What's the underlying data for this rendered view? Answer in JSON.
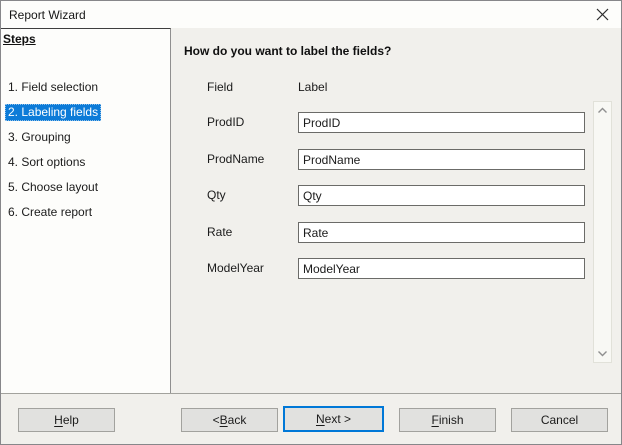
{
  "window": {
    "title": "Report Wizard"
  },
  "sidebar": {
    "heading": "Steps",
    "selected_index": 1,
    "items": [
      {
        "label": "1. Field selection"
      },
      {
        "label": "2. Labeling fields"
      },
      {
        "label": "3. Grouping"
      },
      {
        "label": "4. Sort options"
      },
      {
        "label": "5. Choose layout"
      },
      {
        "label": "6. Create report"
      }
    ]
  },
  "main": {
    "question": "How do you want to label the fields?",
    "columns": {
      "field": "Field",
      "label": "Label"
    },
    "rows": [
      {
        "field": "ProdID",
        "label_value": "ProdID"
      },
      {
        "field": "ProdName",
        "label_value": "ProdName"
      },
      {
        "field": "Qty",
        "label_value": "Qty"
      },
      {
        "field": "Rate",
        "label_value": "Rate"
      },
      {
        "field": "ModelYear",
        "label_value": "ModelYear"
      }
    ]
  },
  "buttons": {
    "help": {
      "label": "Help",
      "underline_index": 0
    },
    "back": {
      "label": "< Back",
      "underline_index": 2
    },
    "next": {
      "label": "Next >",
      "underline_index": 0
    },
    "finish": {
      "label": "Finish",
      "underline_index": 0
    },
    "cancel": {
      "label": "Cancel",
      "underline_index": -1
    }
  },
  "colors": {
    "accent": "#0078d7",
    "selection_bg": "#0c7bd8",
    "selection_text": "#ffffff",
    "panel_bg": "#f1f0ec"
  }
}
